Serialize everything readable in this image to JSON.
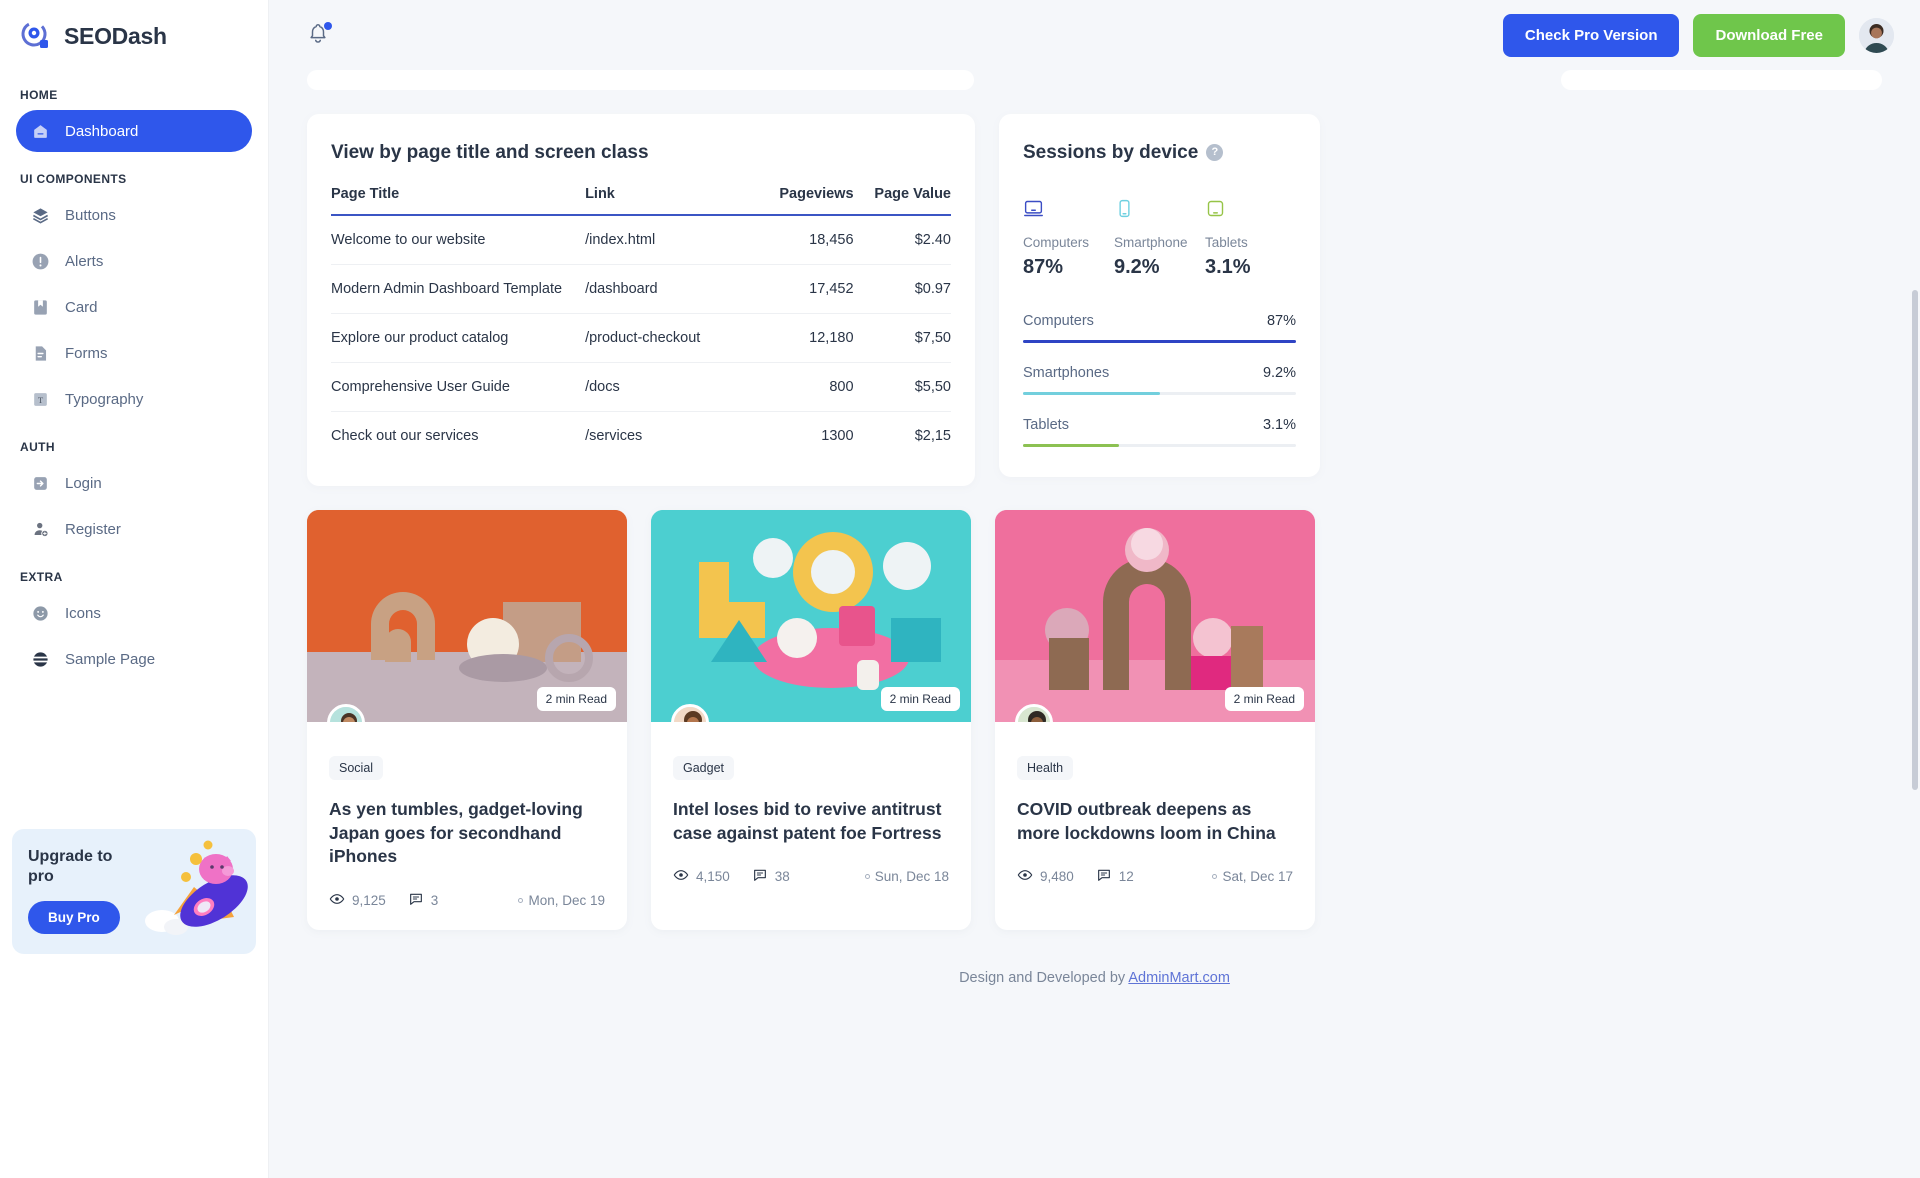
{
  "brand": {
    "name": "SEODash",
    "logo_icon": "seodash-logo-icon"
  },
  "sidebar": {
    "sections": [
      {
        "caption": "HOME",
        "items": [
          {
            "label": "Dashboard",
            "icon": "home-icon",
            "active": true
          }
        ]
      },
      {
        "caption": "UI COMPONENTS",
        "items": [
          {
            "label": "Buttons",
            "icon": "layers-icon"
          },
          {
            "label": "Alerts",
            "icon": "alert-circle-icon"
          },
          {
            "label": "Card",
            "icon": "card-bookmark-icon"
          },
          {
            "label": "Forms",
            "icon": "file-text-icon"
          },
          {
            "label": "Typography",
            "icon": "typography-icon"
          }
        ]
      },
      {
        "caption": "AUTH",
        "items": [
          {
            "label": "Login",
            "icon": "login-arrow-icon"
          },
          {
            "label": "Register",
            "icon": "user-plus-icon"
          }
        ]
      },
      {
        "caption": "EXTRA",
        "items": [
          {
            "label": "Icons",
            "icon": "mood-smile-icon"
          },
          {
            "label": "Sample Page",
            "icon": "sphere-icon"
          }
        ]
      }
    ],
    "promo": {
      "title": "Upgrade to pro",
      "button": "Buy Pro",
      "image_icon": "rocket-piggy-icon"
    }
  },
  "topbar": {
    "notification_icon": "bell-icon",
    "has_notification": true,
    "pro_button": "Check Pro Version",
    "free_button": "Download Free",
    "avatar_icon": "user-avatar"
  },
  "page_table": {
    "title": "View by page title and screen class",
    "columns": [
      "Page Title",
      "Link",
      "Pageviews",
      "Page Value"
    ],
    "rows": [
      {
        "title": "Welcome to our website",
        "link": "/index.html",
        "pageviews": "18,456",
        "value": "$2.40"
      },
      {
        "title": "Modern Admin Dashboard Template",
        "link": "/dashboard",
        "pageviews": "17,452",
        "value": "$0.97"
      },
      {
        "title": "Explore our product catalog",
        "link": "/product-checkout",
        "pageviews": "12,180",
        "value": "$7,50"
      },
      {
        "title": "Comprehensive User Guide",
        "link": "/docs",
        "pageviews": "800",
        "value": "$5,50"
      },
      {
        "title": "Check out our services",
        "link": "/services",
        "pageviews": "1300",
        "value": "$2,15"
      }
    ]
  },
  "sessions": {
    "title": "Sessions by device",
    "help_label": "?",
    "devices": [
      {
        "label": "Computers",
        "value": "87%",
        "icon": "desktop-icon",
        "color": "#3b4dc4"
      },
      {
        "label": "Smartphone",
        "value": "9.2%",
        "icon": "smartphone-icon",
        "color": "#6ed0e0"
      },
      {
        "label": "Tablets",
        "value": "3.1%",
        "icon": "tablet-icon",
        "color": "#96c447"
      }
    ],
    "bars": [
      {
        "label": "Computers",
        "value": "87%",
        "fill_pct": 100,
        "color": "#2f44c4"
      },
      {
        "label": "Smartphones",
        "value": "9.2%",
        "fill_pct": 50,
        "color": "#72cfdd"
      },
      {
        "label": "Tablets",
        "value": "3.1%",
        "fill_pct": 35,
        "color": "#8cc152"
      }
    ]
  },
  "blog": {
    "posts": [
      {
        "read_time": "2 min Read",
        "tag": "Social",
        "title": "As yen tumbles, gadget-loving Japan goes for secondhand iPhones",
        "views": "9,125",
        "comments": "3",
        "date": "Mon, Dec 19",
        "image_bg": "#e0612f",
        "image_icon": "abstract-shapes-orange"
      },
      {
        "read_time": "2 min Read",
        "tag": "Gadget",
        "title": "Intel loses bid to revive antitrust case against patent foe Fortress",
        "views": "4,150",
        "comments": "38",
        "date": "Sun, Dec 18",
        "image_bg": "#4ccfd0",
        "image_icon": "abstract-shapes-teal"
      },
      {
        "read_time": "2 min Read",
        "tag": "Health",
        "title": "COVID outbreak deepens as more lockdowns loom in China",
        "views": "9,480",
        "comments": "12",
        "date": "Sat, Dec 17",
        "image_bg": "#f0709c",
        "image_icon": "abstract-shapes-pink"
      }
    ]
  },
  "footer": {
    "text": "Design and Developed by ",
    "link": "AdminMart.com"
  }
}
